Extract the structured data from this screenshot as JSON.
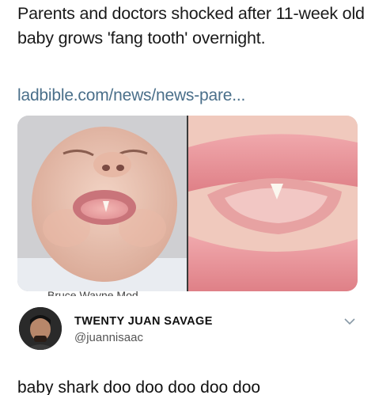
{
  "post": {
    "headline": "Parents and doctors shocked after 11-week old baby grows 'fang tooth' overnight.",
    "link": "ladbible.com/news/news-pare..."
  },
  "image": {
    "caption_partial": "Bruce Wayne Mod"
  },
  "tweet": {
    "display_name": "TWENTY JUAN SAVAGE",
    "handle": "@juannisaac",
    "text": "baby shark doo doo doo doo doo"
  },
  "icons": {
    "menu": "chevron-down-icon",
    "avatar": "avatar"
  }
}
